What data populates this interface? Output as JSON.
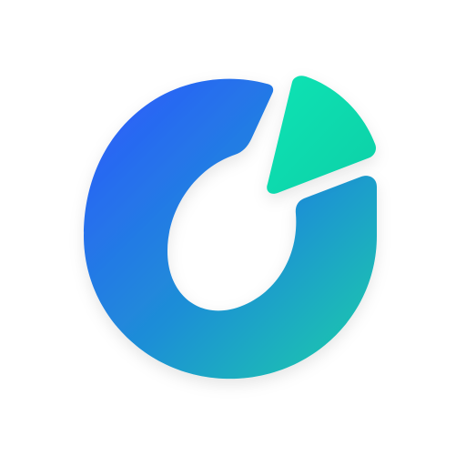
{
  "app": {
    "icon_name": "app-logo-icon",
    "colors": {
      "background": "#ffffff",
      "ring_top": "#2a63f6",
      "ring_mid": "#1e8fd6",
      "ring_bottom": "#19c3b0",
      "wedge_light": "#10e3b4",
      "wedge_dark": "#0fd0a7"
    }
  }
}
